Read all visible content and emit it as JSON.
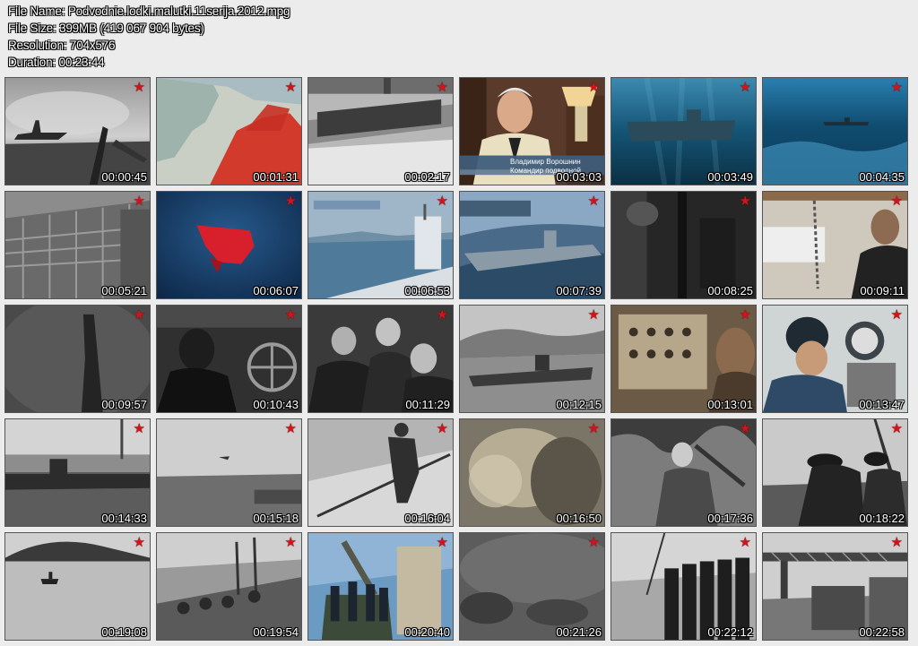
{
  "info": {
    "file_name": "File Name: Podvodnie.lodki.malutki.11serija.2012.mpg",
    "file_size": "File Size: 399MB (419 067 904 bytes)",
    "resolution": "Resolution: 704x576",
    "duration": "Duration: 00:23:44"
  },
  "star_icon": "red-star-icon",
  "star_color": "#d1141b",
  "thumbnails": [
    {
      "time": "00:00:45",
      "scene": "warship-grey"
    },
    {
      "time": "00:01:31",
      "scene": "map"
    },
    {
      "time": "00:02:17",
      "scene": "deck-grey"
    },
    {
      "time": "00:03:03",
      "scene": "interview",
      "captions": [
        "Владимир Ворошнин",
        "Командир подводной"
      ]
    },
    {
      "time": "00:03:49",
      "scene": "underwater-sub"
    },
    {
      "time": "00:04:35",
      "scene": "underwater-far"
    },
    {
      "time": "00:05:21",
      "scene": "shipyard"
    },
    {
      "time": "00:06:07",
      "scene": "red-hull"
    },
    {
      "time": "00:06:53",
      "scene": "sub-sea"
    },
    {
      "time": "00:07:39",
      "scene": "sub-render"
    },
    {
      "time": "00:08:25",
      "scene": "dark-interior"
    },
    {
      "time": "00:09:11",
      "scene": "sailor-bunk"
    },
    {
      "time": "00:09:57",
      "scene": "periscope-fog"
    },
    {
      "time": "00:10:43",
      "scene": "sailor-wheel"
    },
    {
      "time": "00:11:29",
      "scene": "crew-group"
    },
    {
      "time": "00:12:15",
      "scene": "sub-harbor"
    },
    {
      "time": "00:13:01",
      "scene": "control-panel"
    },
    {
      "time": "00:13:47",
      "scene": "sailor-instrument"
    },
    {
      "time": "00:14:33",
      "scene": "sub-dock"
    },
    {
      "time": "00:15:18",
      "scene": "sea-plane"
    },
    {
      "time": "00:16:04",
      "scene": "sailor-deck"
    },
    {
      "time": "00:16:50",
      "scene": "blur-brown"
    },
    {
      "time": "00:17:36",
      "scene": "soldier-forest"
    },
    {
      "time": "00:18:22",
      "scene": "gunner"
    },
    {
      "time": "00:19:08",
      "scene": "boat-sea"
    },
    {
      "time": "00:19:54",
      "scene": "crew-boat"
    },
    {
      "time": "00:20:40",
      "scene": "gun-crew-color"
    },
    {
      "time": "00:21:26",
      "scene": "fog-dark"
    },
    {
      "time": "00:22:12",
      "scene": "crew-line"
    },
    {
      "time": "00:22:58",
      "scene": "crane-dock"
    }
  ]
}
